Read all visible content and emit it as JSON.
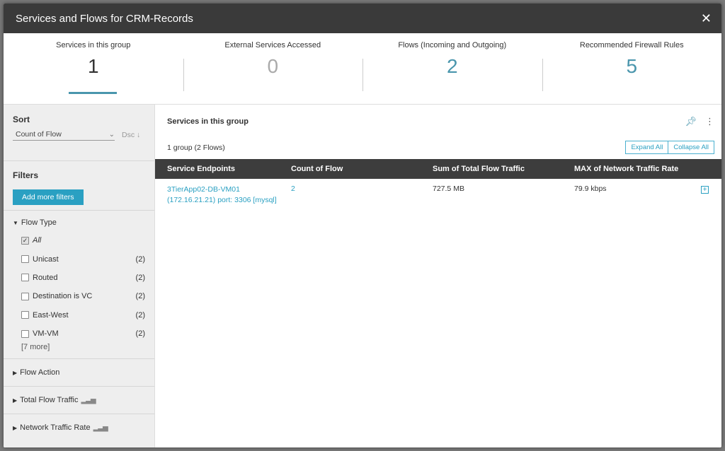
{
  "window": {
    "title": "Services and Flows for CRM-Records"
  },
  "stats": [
    {
      "label": "Services in this group",
      "value": "1"
    },
    {
      "label": "External Services Accessed",
      "value": "0"
    },
    {
      "label": "Flows (Incoming and Outgoing)",
      "value": "2"
    },
    {
      "label": "Recommended Firewall Rules",
      "value": "5"
    }
  ],
  "sidebar": {
    "sort_title": "Sort",
    "sort_value": "Count of Flow",
    "sort_direction": "Dsc",
    "filters_title": "Filters",
    "add_filters_label": "Add more filters",
    "flow_type": {
      "label": "Flow Type",
      "all_label": "All",
      "options": [
        {
          "label": "Unicast",
          "count": "(2)"
        },
        {
          "label": "Routed",
          "count": "(2)"
        },
        {
          "label": "Destination is VC",
          "count": "(2)"
        },
        {
          "label": "East-West",
          "count": "(2)"
        },
        {
          "label": "VM-VM",
          "count": "(2)"
        }
      ],
      "more_label": "[7 more]"
    },
    "collapsed_groups": [
      "Flow Action",
      "Total Flow Traffic",
      "Network Traffic Rate"
    ]
  },
  "main": {
    "heading": "Services in this group",
    "summary": "1 group (2 Flows)",
    "expand_all": "Expand All",
    "collapse_all": "Collapse All",
    "columns": [
      "Service Endpoints",
      "Count of Flow",
      "Sum of Total Flow Traffic",
      "MAX of Network Traffic Rate"
    ],
    "rows": [
      {
        "endpoint_line1": "3TierApp02-DB-VM01",
        "endpoint_line2": "(172.16.21.21) port: 3306 [mysql]",
        "count": "2",
        "traffic": "727.5 MB",
        "rate": "79.9 kbps"
      }
    ]
  },
  "colors": {
    "accent": "#4a96ad",
    "button": "#2aa0c2",
    "titlebar": "#3a3a3a"
  }
}
